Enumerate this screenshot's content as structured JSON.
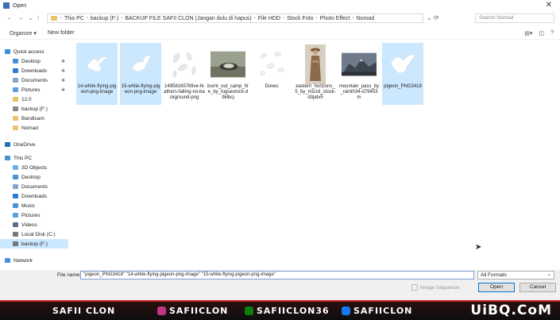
{
  "window": {
    "title": "Open",
    "close_glyph": "✕"
  },
  "address": {
    "crumbs": [
      "This PC",
      "backup (F:)",
      "BACKUP FILE SAFII CLON (Jangan dulu di hapus)",
      "File HDD",
      "Stock Foto",
      "Photo Effect",
      "Nomad"
    ],
    "search_placeholder": "Search Nomad"
  },
  "toolbar": {
    "organize": "Organize ▾",
    "new_folder": "New folder"
  },
  "nav": {
    "quick_access": "Quick access",
    "desktop": "Desktop",
    "downloads": "Downloads",
    "documents": "Documents",
    "pictures": "Pictures",
    "f12": "12.0",
    "backup": "backup (F:)",
    "bandicam": "Bandicam",
    "nomad": "Nomad",
    "onedrive": "OneDrive",
    "thispc": "This PC",
    "objects3d": "3D Objects",
    "desktop2": "Desktop",
    "documents2": "Documents",
    "downloads2": "Downloads",
    "music": "Music",
    "pictures2": "Pictures",
    "videos": "Videos",
    "localdisk": "Local Disk (C:)",
    "backup2": "backup (F:)",
    "network": "Network"
  },
  "files": [
    {
      "name": "14-white-flying-pigeon-png-image",
      "selected": true,
      "kind": "dove"
    },
    {
      "name": "15-white-flying-pigeon-png-image",
      "selected": true,
      "kind": "dove"
    },
    {
      "name": "1495816576five-feathers-falling-no-background-png",
      "selected": false,
      "kind": "feathers"
    },
    {
      "name": "burnt_out_camp_fire_by_fuguestock-d9klbcj",
      "selected": false,
      "kind": "camp"
    },
    {
      "name": "Doves",
      "selected": false,
      "kind": "doves"
    },
    {
      "name": "eastern_horizons_5_by_mizzd_stock-d3jatv5",
      "selected": false,
      "kind": "woman"
    },
    {
      "name": "mountain_pass_by_rainth34-d79453m",
      "selected": false,
      "kind": "mountain"
    },
    {
      "name": "pigeon_PNG3418",
      "selected": true,
      "kind": "dove"
    }
  ],
  "footer": {
    "filename_label": "File name:",
    "filename_value": "\"pigeon_PNG3418\" \"14-white-flying-pigeon-png-image\" \"15-white-flying-pigeon-png-image\"",
    "format": "All Formats",
    "image_sequence": "Image Sequence",
    "open": "Open",
    "cancel": "Cancel"
  },
  "banner": {
    "channel": "SAFII CLON",
    "instagram": "SAFIICLON",
    "game": "SAFIICLON36",
    "facebook": "SAFIICLON",
    "watermark": "UiBQ.CoM"
  },
  "colors": {
    "selection": "#cce8ff",
    "banner_accent": "#c0262d"
  }
}
